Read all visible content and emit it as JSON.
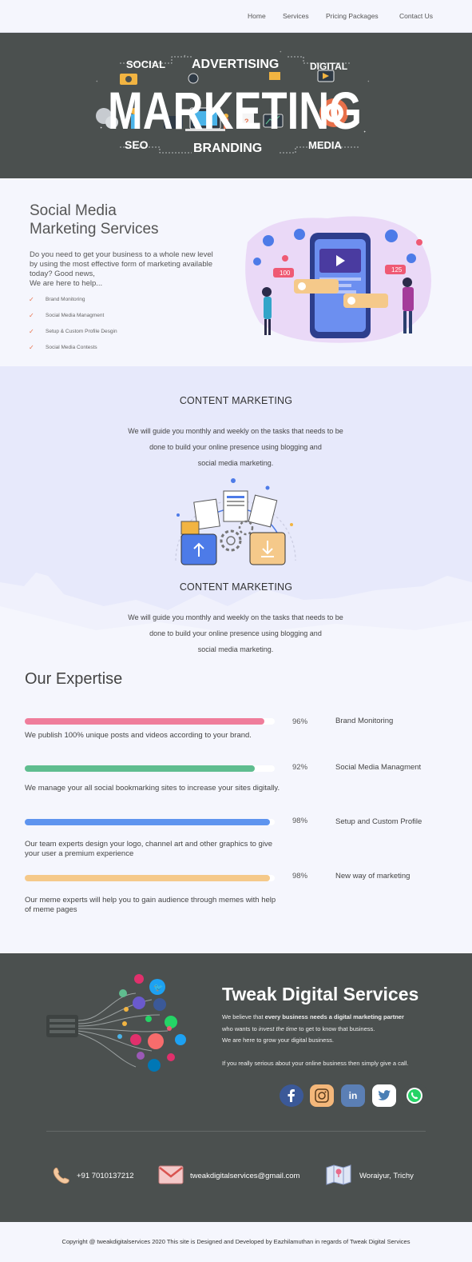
{
  "nav": {
    "items": [
      {
        "label": "Home"
      },
      {
        "label": "Services"
      },
      {
        "label": "Pricing Packages"
      },
      {
        "label": "Contact Us"
      }
    ]
  },
  "hero": {
    "words": {
      "social": "SOCIAL",
      "advertising": "ADVERTISING",
      "digital": "DIGITAL",
      "marketing": "MARKETING",
      "seo": "SEO",
      "branding": "BRANDING",
      "media": "MEDIA"
    }
  },
  "sms": {
    "title_line1": "Social Media",
    "title_line2": "Marketing Services",
    "description": "Do you need to get your business to a whole new level by using the most effective form of marketing available today? Good news,",
    "description_2": "We are here to help...",
    "items": [
      {
        "label": "Brand Monitoring"
      },
      {
        "label": "Social Media Managment"
      },
      {
        "label": "Setup & Custom Profile Desgin"
      },
      {
        "label": "Social Media Contests"
      }
    ],
    "art": {
      "likes_100": "100",
      "likes_125": "125"
    }
  },
  "content_marketing": {
    "blocks": [
      {
        "title": "CONTENT MARKETING",
        "line1": "We will guide you monthly and weekly on the tasks that needs to be",
        "line2": "done to build your online presence using blogging and",
        "line3": "social media marketing."
      },
      {
        "title": "CONTENT MARKETING",
        "line1": "We will guide you monthly and weekly on the tasks that needs to be",
        "line2": "done to build your online presence using blogging and",
        "line3": "social media marketing."
      }
    ]
  },
  "expertise": {
    "title": "Our Expertise",
    "items": [
      {
        "percent": "96%",
        "value": 0.96,
        "name": "Brand Monitoring",
        "desc": "We publish 100% unique posts and videos according to your brand.",
        "color": "#ef7d9b"
      },
      {
        "percent": "92%",
        "value": 0.92,
        "name": "Social Media Managment",
        "desc": "We manage your all social bookmarking sites to increase your sites digitally.",
        "color": "#5fbd8f"
      },
      {
        "percent": "98%",
        "value": 0.98,
        "name": "Setup and Custom Profile",
        "desc": "Our team experts design your logo, channel art and other graphics to give your user a premium experience",
        "color": "#5e94ef"
      },
      {
        "percent": "98%",
        "value": 0.98,
        "name": "New way of marketing",
        "desc": "Our meme experts will help you to gain audience through memes with help of meme pages",
        "color": "#f5c98a"
      }
    ]
  },
  "footer": {
    "brand": "Tweak Digital Services",
    "line1_pre": "We believe that ",
    "line1_bold": "every business needs a digital marketing partner",
    "line2_pre": "who wants to ",
    "line2_italic": "invest the time",
    "line2_post": " to get to know that business.",
    "line3": "We are here to grow your digital business.",
    "line4": "If you really serious about your online business then simply give a call.",
    "phone": "+91 7010137212",
    "email": "tweakdigitalservices@gmail.com",
    "address": "Woraiyur, Trichy"
  },
  "copyright": "Copyright @ tweakdigitalservices 2020 This site is Designed and Developed by Eazhilamuthan in regards of Tweak Digital Services"
}
